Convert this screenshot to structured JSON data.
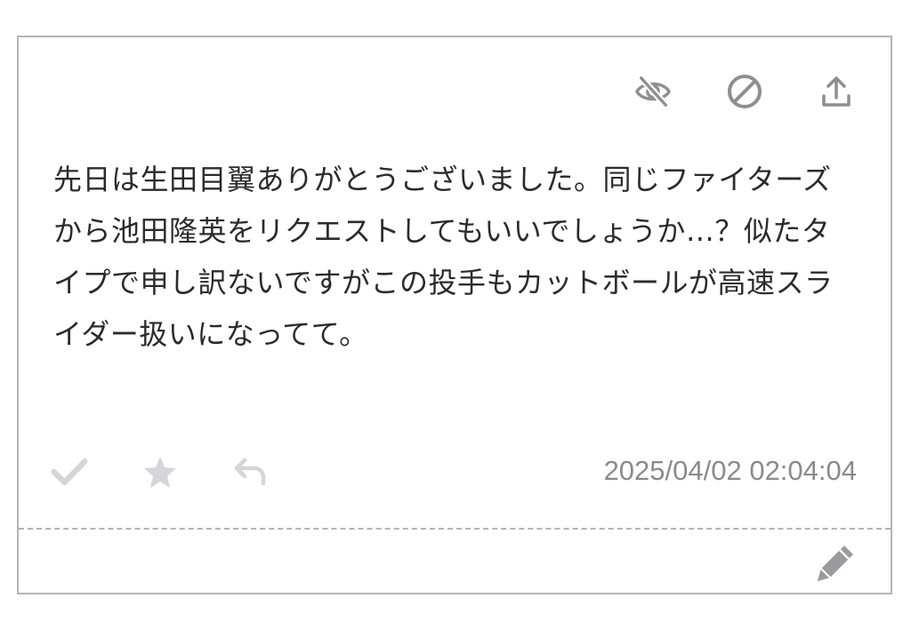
{
  "message": {
    "body": "先日は生田目翼ありがとうございました。同じファイターズから池田隆英をリクエストしてもいいでしょうか…？似たタイプで申し訳ないですがこの投手もカットボールが高速スライダー扱いになってて。",
    "timestamp": "2025/04/02 02:04:04"
  },
  "icons": {
    "top": [
      "eye-off-icon",
      "block-icon",
      "share-upload-icon"
    ],
    "bottom": [
      "check-icon",
      "star-icon",
      "reply-icon"
    ],
    "footer": "pencil-icon"
  },
  "colors": {
    "icon_dark": "#8e8e93",
    "icon_light": "#d5d5da",
    "border": "#b4b4b9",
    "text": "#2b2b2b"
  }
}
